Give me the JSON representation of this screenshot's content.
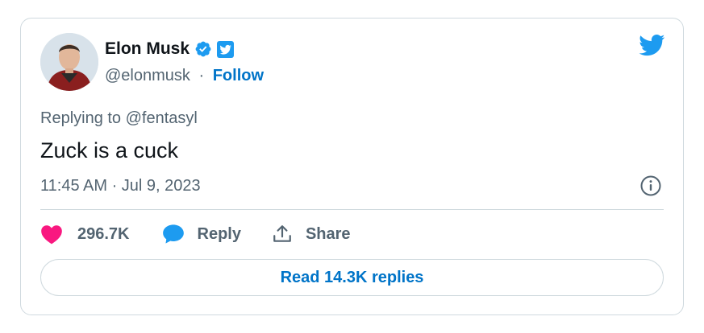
{
  "author": {
    "name": "Elon Musk",
    "handle": "@elonmusk",
    "separator": "·",
    "follow_label": "Follow",
    "verified_icon": "verified-badge-icon",
    "affiliate_icon": "twitter-badge-icon"
  },
  "brand_icon": "twitter-bird-icon",
  "tweet": {
    "replying_to": "Replying to @fentasyl",
    "text": "Zuck is a cuck",
    "timestamp": "11:45 AM · Jul 9, 2023"
  },
  "actions": {
    "like_count": "296.7K",
    "reply_label": "Reply",
    "share_label": "Share"
  },
  "read_replies_label": "Read 14.3K replies",
  "colors": {
    "accent": "#1d9bf0",
    "link": "#0074c8",
    "like": "#f91880",
    "text_secondary": "#536471",
    "border": "#cfd9de"
  }
}
